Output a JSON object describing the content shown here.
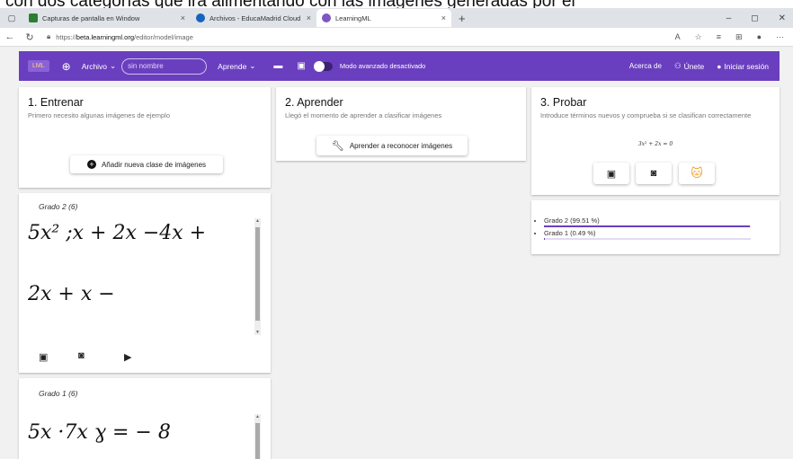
{
  "top_caption": "con dos categorías que irá alimentando con las imágenes generadas por el",
  "browser": {
    "tabs": [
      {
        "label": "Capturas de pantalla en Window",
        "color": "#2e7d32"
      },
      {
        "label": "Archivos - EducaMadrid Cloud",
        "color": "#1565c0"
      },
      {
        "label": "LearningML",
        "color": "#7e57c2"
      }
    ],
    "new_tab": "+",
    "url_prefix": "https://",
    "url_host": "beta.learningml.org",
    "url_path": "/editor/model/image",
    "window_controls": [
      "–",
      "◻",
      "✕"
    ]
  },
  "appbar": {
    "logo": "LML",
    "file_menu": "Archivo",
    "name_input_value": "sin nombre",
    "learn_menu": "Aprende",
    "advanced_mode": "Modo avanzado desactivado",
    "about": "Acerca de",
    "join": "Únete",
    "login": "Iniciar sesión"
  },
  "train": {
    "title": "1. Entrenar",
    "subtitle": "Primero necesito algunas imágenes de ejemplo",
    "add_class_button": "Añadir nueva clase de imágenes",
    "classes": [
      {
        "name": "Grado 2 (6)",
        "samples": [
          "5x² ;x + 2x −4x +",
          "2x + x −"
        ]
      },
      {
        "name": "Grado 1 (6)",
        "samples": [
          "5x ·7x ɣ = − 8"
        ]
      }
    ]
  },
  "learn": {
    "title": "2. Aprender",
    "subtitle": "Llegó el momento de aprender a clasificar imágenes",
    "button": "Aprender a reconocer imágenes"
  },
  "test": {
    "title": "3. Probar",
    "subtitle": "Introduce términos nuevos y comprueba si se clasifican correctamente",
    "formula": "3x² + 2x = 0",
    "results": [
      {
        "label": "Grado 2 (99.51 %)",
        "value": 0.9951
      },
      {
        "label": "Grado 1 (0.49 %)",
        "value": 0.0049
      }
    ]
  },
  "colors": {
    "accent": "#6a3fbf",
    "accent_light": "#e2dbf2"
  }
}
